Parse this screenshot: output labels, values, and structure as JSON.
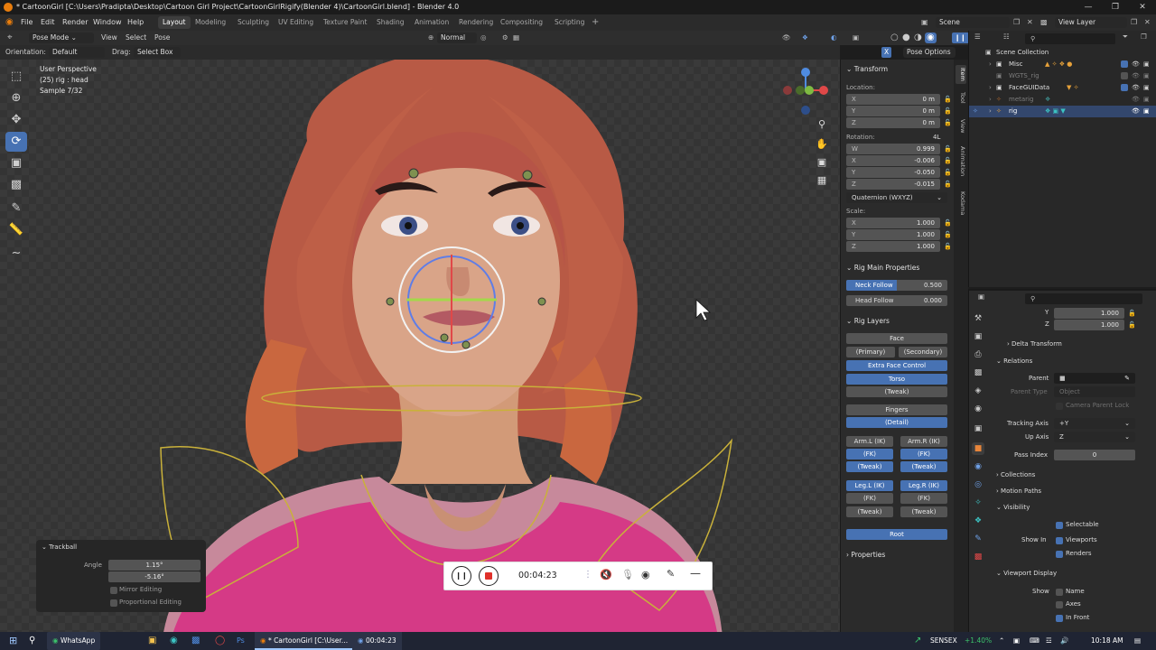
{
  "window": {
    "title": "* CartoonGirl [C:\\Users\\Pradipta\\Desktop\\Cartoon Girl Project\\CartoonGirlRigify(Blender 4)\\CartoonGirl.blend] - Blender 4.0"
  },
  "menu": {
    "items": [
      "File",
      "Edit",
      "Render",
      "Window",
      "Help"
    ],
    "workspaces": [
      "Layout",
      "Modeling",
      "Sculpting",
      "UV Editing",
      "Texture Paint",
      "Shading",
      "Animation",
      "Rendering",
      "Compositing",
      "Scripting"
    ],
    "active_workspace": "Layout",
    "scene": "Scene",
    "view_layer": "View Layer"
  },
  "header": {
    "mode": "Pose Mode",
    "view": "View",
    "select": "Select",
    "pose": "Pose",
    "pivot": "Normal",
    "pose_options": "Pose Options"
  },
  "tool_options": {
    "orientation_label": "Orientation:",
    "orientation_value": "Default",
    "drag_label": "Drag:",
    "drag_value": "Select Box"
  },
  "viewport": {
    "info": [
      "User Perspective",
      "(25) rig : head",
      "Sample 7/32"
    ]
  },
  "npanel": {
    "tabs": [
      "Item",
      "Tool",
      "View",
      "Animation",
      "Kodama"
    ],
    "transform_title": "Transform",
    "location_label": "Location:",
    "location": [
      {
        "k": "X",
        "v": "0 m"
      },
      {
        "k": "Y",
        "v": "0 m"
      },
      {
        "k": "Z",
        "v": "0 m"
      }
    ],
    "rotation_label": "Rotation:",
    "rotation_lock": "4L",
    "rotation": [
      {
        "k": "W",
        "v": "0.999"
      },
      {
        "k": "X",
        "v": "-0.006"
      },
      {
        "k": "Y",
        "v": "-0.050"
      },
      {
        "k": "Z",
        "v": "-0.015"
      }
    ],
    "rotation_mode": "Quaternion (WXYZ)",
    "scale_label": "Scale:",
    "scale": [
      {
        "k": "X",
        "v": "1.000"
      },
      {
        "k": "Y",
        "v": "1.000"
      },
      {
        "k": "Z",
        "v": "1.000"
      }
    ],
    "rig_main_title": "Rig Main Properties",
    "neck_follow_label": "Neck Follow",
    "neck_follow_value": "0.500",
    "head_follow_label": "Head Follow",
    "head_follow_value": "0.000",
    "rig_layers_title": "Rig Layers",
    "layers": {
      "face": "Face",
      "primary": "(Primary)",
      "secondary": "(Secondary)",
      "extra_face": "Extra Face Control",
      "torso": "Torso",
      "tweak": "(Tweak)",
      "fingers": "Fingers",
      "detail": "(Detail)",
      "arm_l_ik": "Arm.L (IK)",
      "arm_r_ik": "Arm.R (IK)",
      "arm_l_fk": "(FK)",
      "arm_r_fk": "(FK)",
      "arm_l_tweak": "(Tweak)",
      "arm_r_tweak": "(Tweak)",
      "leg_l_ik": "Leg.L (IK)",
      "leg_r_ik": "Leg.R (IK)",
      "leg_l_fk": "(FK)",
      "leg_r_fk": "(FK)",
      "leg_l_tweak": "(Tweak)",
      "leg_r_tweak": "(Tweak)",
      "root": "Root"
    },
    "properties_title": "Properties"
  },
  "outliner": {
    "rows": [
      "Scene Collection",
      "Misc",
      "WGTS_rig",
      "FaceGUIData",
      "metarig",
      "rig"
    ]
  },
  "properties": {
    "y_label": "Y",
    "y_value": "1.000",
    "z_label": "Z",
    "z_value": "1.000",
    "delta_transform": "Delta Transform",
    "relations": "Relations",
    "parent_label": "Parent",
    "parent_type_label": "Parent Type",
    "parent_type_value": "Object",
    "camera_parent_lock": "Camera Parent Lock",
    "tracking_axis_label": "Tracking Axis",
    "tracking_axis_value": "+Y",
    "up_axis_label": "Up Axis",
    "up_axis_value": "Z",
    "pass_index_label": "Pass Index",
    "pass_index_value": "0",
    "collections": "Collections",
    "motion_paths": "Motion Paths",
    "visibility": "Visibility",
    "selectable": "Selectable",
    "show_in_label": "Show In",
    "viewports": "Viewports",
    "renders": "Renders",
    "viewport_display": "Viewport Display",
    "show_label": "Show",
    "name": "Name",
    "axes": "Axes",
    "in_front": "In Front"
  },
  "trackball": {
    "title": "Trackball",
    "angle_label": "Angle",
    "angle_1": "1.15°",
    "angle_2": "-5.16°",
    "mirror_editing": "Mirror Editing",
    "proportional_editing": "Proportional Editing"
  },
  "recorder": {
    "time": "00:04:23"
  },
  "taskbar": {
    "whatsapp": "WhatsApp",
    "blender_task": "* CartoonGirl [C:\\User...",
    "recorder_task": "00:04:23",
    "sensex_label": "SENSEX",
    "sensex_value": "+1.40%",
    "clock": "10:18 AM"
  },
  "colors": {
    "accent_blue": "#4772b3",
    "sensex_green": "#3cc36b",
    "record_red": "#e0302a",
    "blender_orange": "#e87d0d"
  }
}
